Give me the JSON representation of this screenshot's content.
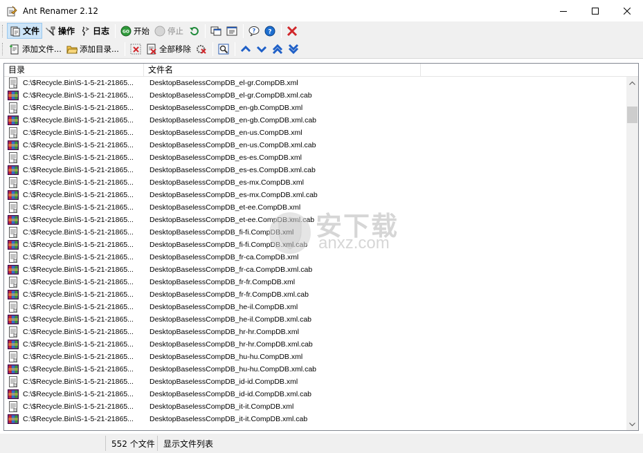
{
  "window": {
    "title": "Ant Renamer 2.12"
  },
  "toolbar_main": {
    "file_label": "文件",
    "actions_label": "操作",
    "log_label": "日志",
    "start_label": "开始",
    "stop_label": "停止"
  },
  "toolbar_files": {
    "add_files_label": "添加文件...",
    "add_folders_label": "添加目录...",
    "remove_all_label": "全部移除"
  },
  "list": {
    "columns": {
      "directory": "目录",
      "filename": "文件名"
    },
    "rows": [
      {
        "dir": "C:\\$Recycle.Bin\\S-1-5-21-21865...",
        "name": "DesktopBaselessCompDB_el-gr.CompDB.xml",
        "type": "xml"
      },
      {
        "dir": "C:\\$Recycle.Bin\\S-1-5-21-21865...",
        "name": "DesktopBaselessCompDB_el-gr.CompDB.xml.cab",
        "type": "cab"
      },
      {
        "dir": "C:\\$Recycle.Bin\\S-1-5-21-21865...",
        "name": "DesktopBaselessCompDB_en-gb.CompDB.xml",
        "type": "xml"
      },
      {
        "dir": "C:\\$Recycle.Bin\\S-1-5-21-21865...",
        "name": "DesktopBaselessCompDB_en-gb.CompDB.xml.cab",
        "type": "cab"
      },
      {
        "dir": "C:\\$Recycle.Bin\\S-1-5-21-21865...",
        "name": "DesktopBaselessCompDB_en-us.CompDB.xml",
        "type": "xml"
      },
      {
        "dir": "C:\\$Recycle.Bin\\S-1-5-21-21865...",
        "name": "DesktopBaselessCompDB_en-us.CompDB.xml.cab",
        "type": "cab"
      },
      {
        "dir": "C:\\$Recycle.Bin\\S-1-5-21-21865...",
        "name": "DesktopBaselessCompDB_es-es.CompDB.xml",
        "type": "xml"
      },
      {
        "dir": "C:\\$Recycle.Bin\\S-1-5-21-21865...",
        "name": "DesktopBaselessCompDB_es-es.CompDB.xml.cab",
        "type": "cab"
      },
      {
        "dir": "C:\\$Recycle.Bin\\S-1-5-21-21865...",
        "name": "DesktopBaselessCompDB_es-mx.CompDB.xml",
        "type": "xml"
      },
      {
        "dir": "C:\\$Recycle.Bin\\S-1-5-21-21865...",
        "name": "DesktopBaselessCompDB_es-mx.CompDB.xml.cab",
        "type": "cab"
      },
      {
        "dir": "C:\\$Recycle.Bin\\S-1-5-21-21865...",
        "name": "DesktopBaselessCompDB_et-ee.CompDB.xml",
        "type": "xml"
      },
      {
        "dir": "C:\\$Recycle.Bin\\S-1-5-21-21865...",
        "name": "DesktopBaselessCompDB_et-ee.CompDB.xml.cab",
        "type": "cab"
      },
      {
        "dir": "C:\\$Recycle.Bin\\S-1-5-21-21865...",
        "name": "DesktopBaselessCompDB_fi-fi.CompDB.xml",
        "type": "xml"
      },
      {
        "dir": "C:\\$Recycle.Bin\\S-1-5-21-21865...",
        "name": "DesktopBaselessCompDB_fi-fi.CompDB.xml.cab",
        "type": "cab"
      },
      {
        "dir": "C:\\$Recycle.Bin\\S-1-5-21-21865...",
        "name": "DesktopBaselessCompDB_fr-ca.CompDB.xml",
        "type": "xml"
      },
      {
        "dir": "C:\\$Recycle.Bin\\S-1-5-21-21865...",
        "name": "DesktopBaselessCompDB_fr-ca.CompDB.xml.cab",
        "type": "cab"
      },
      {
        "dir": "C:\\$Recycle.Bin\\S-1-5-21-21865...",
        "name": "DesktopBaselessCompDB_fr-fr.CompDB.xml",
        "type": "xml"
      },
      {
        "dir": "C:\\$Recycle.Bin\\S-1-5-21-21865...",
        "name": "DesktopBaselessCompDB_fr-fr.CompDB.xml.cab",
        "type": "cab"
      },
      {
        "dir": "C:\\$Recycle.Bin\\S-1-5-21-21865...",
        "name": "DesktopBaselessCompDB_he-il.CompDB.xml",
        "type": "xml"
      },
      {
        "dir": "C:\\$Recycle.Bin\\S-1-5-21-21865...",
        "name": "DesktopBaselessCompDB_he-il.CompDB.xml.cab",
        "type": "cab"
      },
      {
        "dir": "C:\\$Recycle.Bin\\S-1-5-21-21865...",
        "name": "DesktopBaselessCompDB_hr-hr.CompDB.xml",
        "type": "xml"
      },
      {
        "dir": "C:\\$Recycle.Bin\\S-1-5-21-21865...",
        "name": "DesktopBaselessCompDB_hr-hr.CompDB.xml.cab",
        "type": "cab"
      },
      {
        "dir": "C:\\$Recycle.Bin\\S-1-5-21-21865...",
        "name": "DesktopBaselessCompDB_hu-hu.CompDB.xml",
        "type": "xml"
      },
      {
        "dir": "C:\\$Recycle.Bin\\S-1-5-21-21865...",
        "name": "DesktopBaselessCompDB_hu-hu.CompDB.xml.cab",
        "type": "cab"
      },
      {
        "dir": "C:\\$Recycle.Bin\\S-1-5-21-21865...",
        "name": "DesktopBaselessCompDB_id-id.CompDB.xml",
        "type": "xml"
      },
      {
        "dir": "C:\\$Recycle.Bin\\S-1-5-21-21865...",
        "name": "DesktopBaselessCompDB_id-id.CompDB.xml.cab",
        "type": "cab"
      },
      {
        "dir": "C:\\$Recycle.Bin\\S-1-5-21-21865...",
        "name": "DesktopBaselessCompDB_it-it.CompDB.xml",
        "type": "xml"
      },
      {
        "dir": "C:\\$Recycle.Bin\\S-1-5-21-21865...",
        "name": "DesktopBaselessCompDB_it-it.CompDB.xml.cab",
        "type": "cab"
      }
    ]
  },
  "status": {
    "count": "552 个文件",
    "message": "显示文件列表"
  },
  "watermark": {
    "line1": "安下载",
    "line2": "anxz.com"
  },
  "colors": {
    "accent_blue": "#1e5fc7",
    "active_button_bg": "#cce4f7",
    "toolbar_bg": "#f0f0f0",
    "close_red": "#d0262a"
  }
}
